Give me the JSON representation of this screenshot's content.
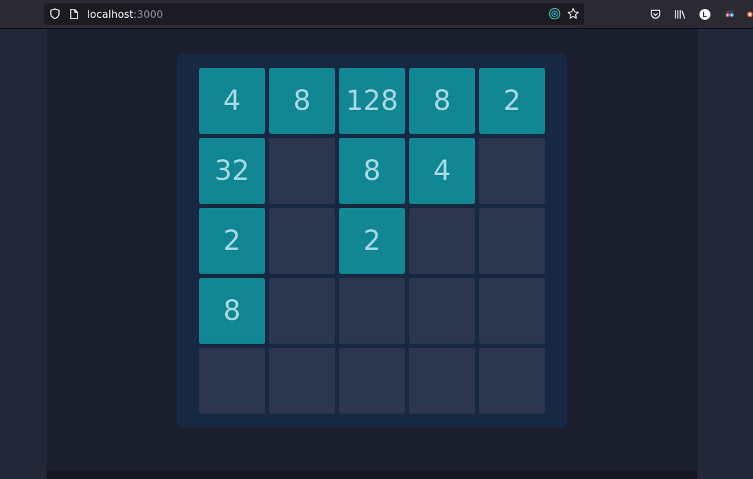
{
  "browser": {
    "url_host": "localhost",
    "url_port": ":3000"
  },
  "board": {
    "rows": [
      [
        "4",
        "8",
        "128",
        "8",
        "2"
      ],
      [
        "32",
        "",
        "8",
        "4",
        ""
      ],
      [
        "2",
        "",
        "2",
        "",
        ""
      ],
      [
        "8",
        "",
        "",
        "",
        ""
      ],
      [
        "",
        "",
        "",
        "",
        ""
      ]
    ]
  },
  "colors": {
    "tile_filled": "#118794",
    "tile_empty": "#2c364e",
    "board_bg": "#172942",
    "tile_text": "#a9d9e3"
  }
}
